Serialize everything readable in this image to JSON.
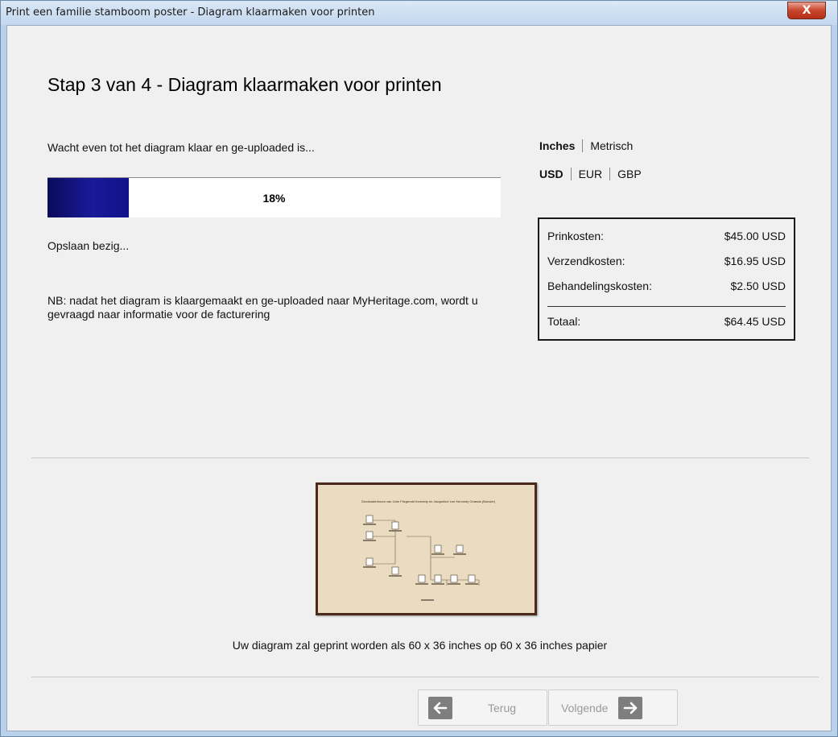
{
  "window": {
    "title": "Print een familie stamboom poster - Diagram klaarmaken voor printen",
    "close_label": "X"
  },
  "step": {
    "heading": "Stap 3 van 4 - Diagram klaarmaken voor printen"
  },
  "upload": {
    "wait_text": "Wacht even tot het diagram klaar en ge-uploaded is...",
    "progress_percent": 18,
    "progress_label": "18%",
    "status_text": "Opslaan bezig...",
    "note_text": "NB: nadat het diagram is klaargemaakt en ge-uploaded naar MyHeritage.com, wordt u gevraagd naar informatie voor de facturering"
  },
  "units": {
    "inches": "Inches",
    "metric": "Metrisch",
    "active": "Inches"
  },
  "currency": {
    "usd": "USD",
    "eur": "EUR",
    "gbp": "GBP",
    "active": "USD"
  },
  "costs": {
    "rows": [
      {
        "label": "Prinkosten:",
        "value": "$45.00 USD"
      },
      {
        "label": "Verzendkosten:",
        "value": "$16.95 USD"
      },
      {
        "label": "Behandelingskosten:",
        "value": "$2.50 USD"
      }
    ],
    "total": {
      "label": "Totaal:",
      "value": "$64.45 USD"
    }
  },
  "preview": {
    "title": "Grootvaderboom van John Fitzgerald Kennedy en Jacqueline Lee Kennedy Onassis (Bouvier)",
    "print_info": "Uw diagram zal geprint worden als 60 x 36 inches op 60 x 36 inches papier",
    "colors": {
      "paper": "#e9dcc0",
      "frame": "#4a2a1a"
    }
  },
  "nav": {
    "back_label": "Terug",
    "next_label": "Volgende"
  },
  "icons": {
    "back": "arrow-left-icon",
    "next": "arrow-right-icon",
    "close": "close-icon"
  },
  "colors": {
    "progress_fill": "#12128a",
    "titlebar": "#c3d7ee",
    "close_button": "#c9452b"
  }
}
